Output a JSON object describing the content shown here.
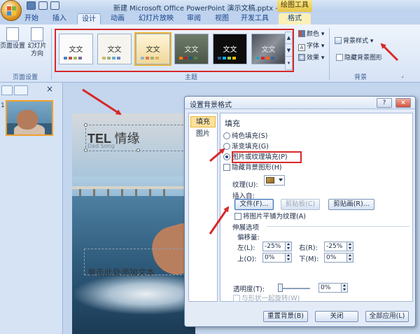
{
  "titlebar": {
    "title": "新建 Microsoft Office PowerPoint 演示文稿.pptx - M",
    "context_tab": "绘图工具"
  },
  "tabs": [
    "开始",
    "插入",
    "设计",
    "动画",
    "幻灯片放映",
    "审阅",
    "视图",
    "开发工具",
    "格式"
  ],
  "active_tab": "设计",
  "ribbon": {
    "page_setup": "页面设置",
    "slide_orientation_line1": "幻灯片",
    "slide_orientation_line2": "方向",
    "page_setup_group": "页面设置",
    "themes_group": "主题",
    "theme_sample_text": "文文",
    "colors": "颜色",
    "fonts": "字体",
    "effects": "效果",
    "background_styles": "背景样式",
    "hide_background_graphics": "隐藏背景图形",
    "background_group": "背景"
  },
  "slide": {
    "number": "1",
    "title_latin": "TEL",
    "title_cjk": "情缘",
    "subtitle": "Dad Song",
    "body_placeholder": "单击此处添加文本"
  },
  "dialog": {
    "title": "设置背景格式",
    "help": "?",
    "close": "×",
    "nav": [
      "填充",
      "图片"
    ],
    "fill_header": "填充",
    "options": {
      "solid_fill": "纯色填充(S)",
      "gradient_fill": "渐变填充(G)",
      "picture_fill": "图片或纹理填充(P)",
      "hide_bg_graphics": "隐藏背景图形(H)"
    },
    "texture_label": "纹理(U):",
    "insert_from": "插入自:",
    "file_button": "文件(F)...",
    "clipboard_button": "剪贴板(C)",
    "clipart_button": "剪贴画(R)...",
    "tile_picture": "将图片平铺为纹理(A)",
    "stretch_options": "伸展选项",
    "offsets": "偏移量:",
    "left_label": "左(L):",
    "left_value": "-25%",
    "right_label": "右(R):",
    "right_value": "-25%",
    "top_label": "上(O):",
    "top_value": "0%",
    "bottom_label": "下(M):",
    "bottom_value": "0%",
    "transparency_label": "透明度(T):",
    "transparency_value": "0%",
    "rotate_with_shape": "与形状一起旋转(W)",
    "reset_button": "重置背景(B)",
    "close_button": "关闭",
    "apply_all_button": "全部应用(L)"
  },
  "colors": {
    "annotation_red": "#d62929",
    "accent_blue": "#15428b",
    "context_tab_yellow": "#f6e58b"
  }
}
